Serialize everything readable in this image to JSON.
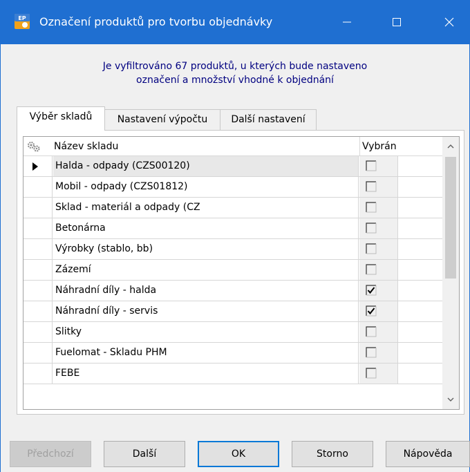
{
  "window": {
    "title": "Označení produktů pro tvorbu objednávky",
    "icon_text": "EP",
    "colors": {
      "titlebar": "#1f6fd1",
      "info_text": "#000080",
      "default_button_border": "#0078d7"
    }
  },
  "info_text": "Je vyfiltrováno 67 produktů, u kterých bude nastaveno\noznačení a množství vhodné k objednání",
  "tabs": [
    {
      "label": "Výběr skladů",
      "active": true
    },
    {
      "label": "Nastavení výpočtu",
      "active": false
    },
    {
      "label": "Další nastavení",
      "active": false
    }
  ],
  "grid": {
    "columns": {
      "name": "Název skladu",
      "select": "Vybrán"
    },
    "rows": [
      {
        "name": "Halda - odpady (CZS00120)",
        "selected": false,
        "current": true
      },
      {
        "name": "Mobil - odpady  (CZS01812)",
        "selected": false,
        "current": false
      },
      {
        "name": "Sklad - materiál a odpady  (CZ",
        "selected": false,
        "current": false
      },
      {
        "name": "Betonárna",
        "selected": false,
        "current": false
      },
      {
        "name": "Výrobky (stablo, bb)",
        "selected": false,
        "current": false
      },
      {
        "name": "Zázemí",
        "selected": false,
        "current": false
      },
      {
        "name": "Náhradní díly - halda",
        "selected": true,
        "current": false
      },
      {
        "name": "Náhradní díly - servis",
        "selected": true,
        "current": false
      },
      {
        "name": "Slitky",
        "selected": false,
        "current": false
      },
      {
        "name": "Fuelomat - Skladu PHM",
        "selected": false,
        "current": false
      },
      {
        "name": "FEBE",
        "selected": false,
        "current": false
      }
    ]
  },
  "buttons": {
    "prev": "Předchozí",
    "next": "Další",
    "ok": "OK",
    "cancel": "Storno",
    "help": "Nápověda"
  }
}
